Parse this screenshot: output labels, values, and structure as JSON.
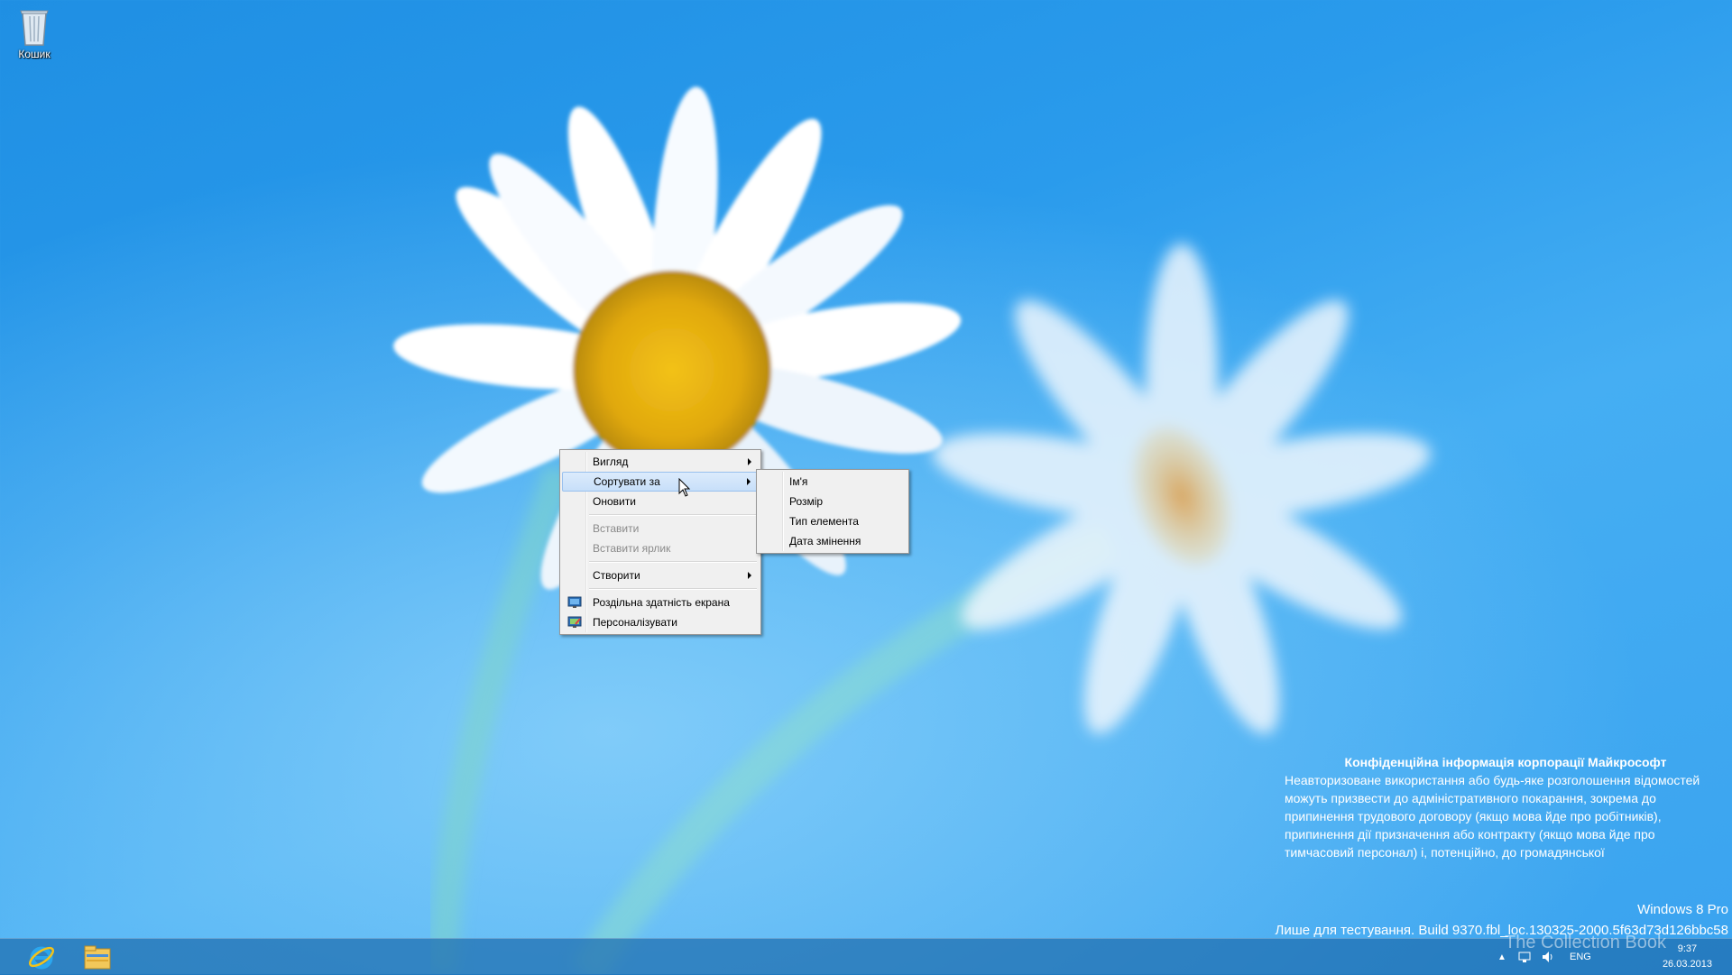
{
  "desktop": {
    "recycle_bin_label": "Кошик"
  },
  "context_menu": {
    "items": [
      {
        "label": "Вигляд",
        "enabled": true,
        "submenu": true
      },
      {
        "label": "Сортувати за",
        "enabled": true,
        "submenu": true,
        "highlighted": true
      },
      {
        "label": "Оновити",
        "enabled": true
      },
      {
        "label": "Вставити",
        "enabled": false
      },
      {
        "label": "Вставити ярлик",
        "enabled": false
      },
      {
        "label": "Створити",
        "enabled": true,
        "submenu": true
      },
      {
        "label": "Роздільна здатність екрана",
        "enabled": true,
        "icon": "display-icon"
      },
      {
        "label": "Персоналізувати",
        "enabled": true,
        "icon": "personalize-icon"
      }
    ]
  },
  "sort_submenu": {
    "items": [
      {
        "label": "Ім'я"
      },
      {
        "label": "Розмір"
      },
      {
        "label": "Тип елемента"
      },
      {
        "label": "Дата змінення"
      }
    ]
  },
  "watermark": {
    "title": "Конфіденційна інформація корпорації Майкрософт",
    "body": "Неавторизоване використання або будь-яке розголошення відомостей можуть призвести до адміністративного покарання, зокрема до припинення трудового договору (якщо мова йде про робітників), припинення дії призначення або контракту (якщо мова йде про тимчасовий персонал) і, потенційно, до громадянської",
    "edition": "Windows 8 Pro",
    "build": "Лише для тестування. Build 9370.fbl_loc.130325-2000.5f63d73d126bbc58"
  },
  "taskbar": {
    "pinned": [
      "ie-icon",
      "explorer-icon"
    ],
    "tray": {
      "language": "ENG",
      "time": "9:37",
      "date": "26.03.2013"
    }
  },
  "overlay_watermark": "The Collection Book",
  "colors": {
    "desktop_bg": "#2a9bec",
    "menu_bg": "#f0f0f0",
    "menu_highlight": "#c7dff9",
    "disabled_text": "#8a8a8a"
  }
}
